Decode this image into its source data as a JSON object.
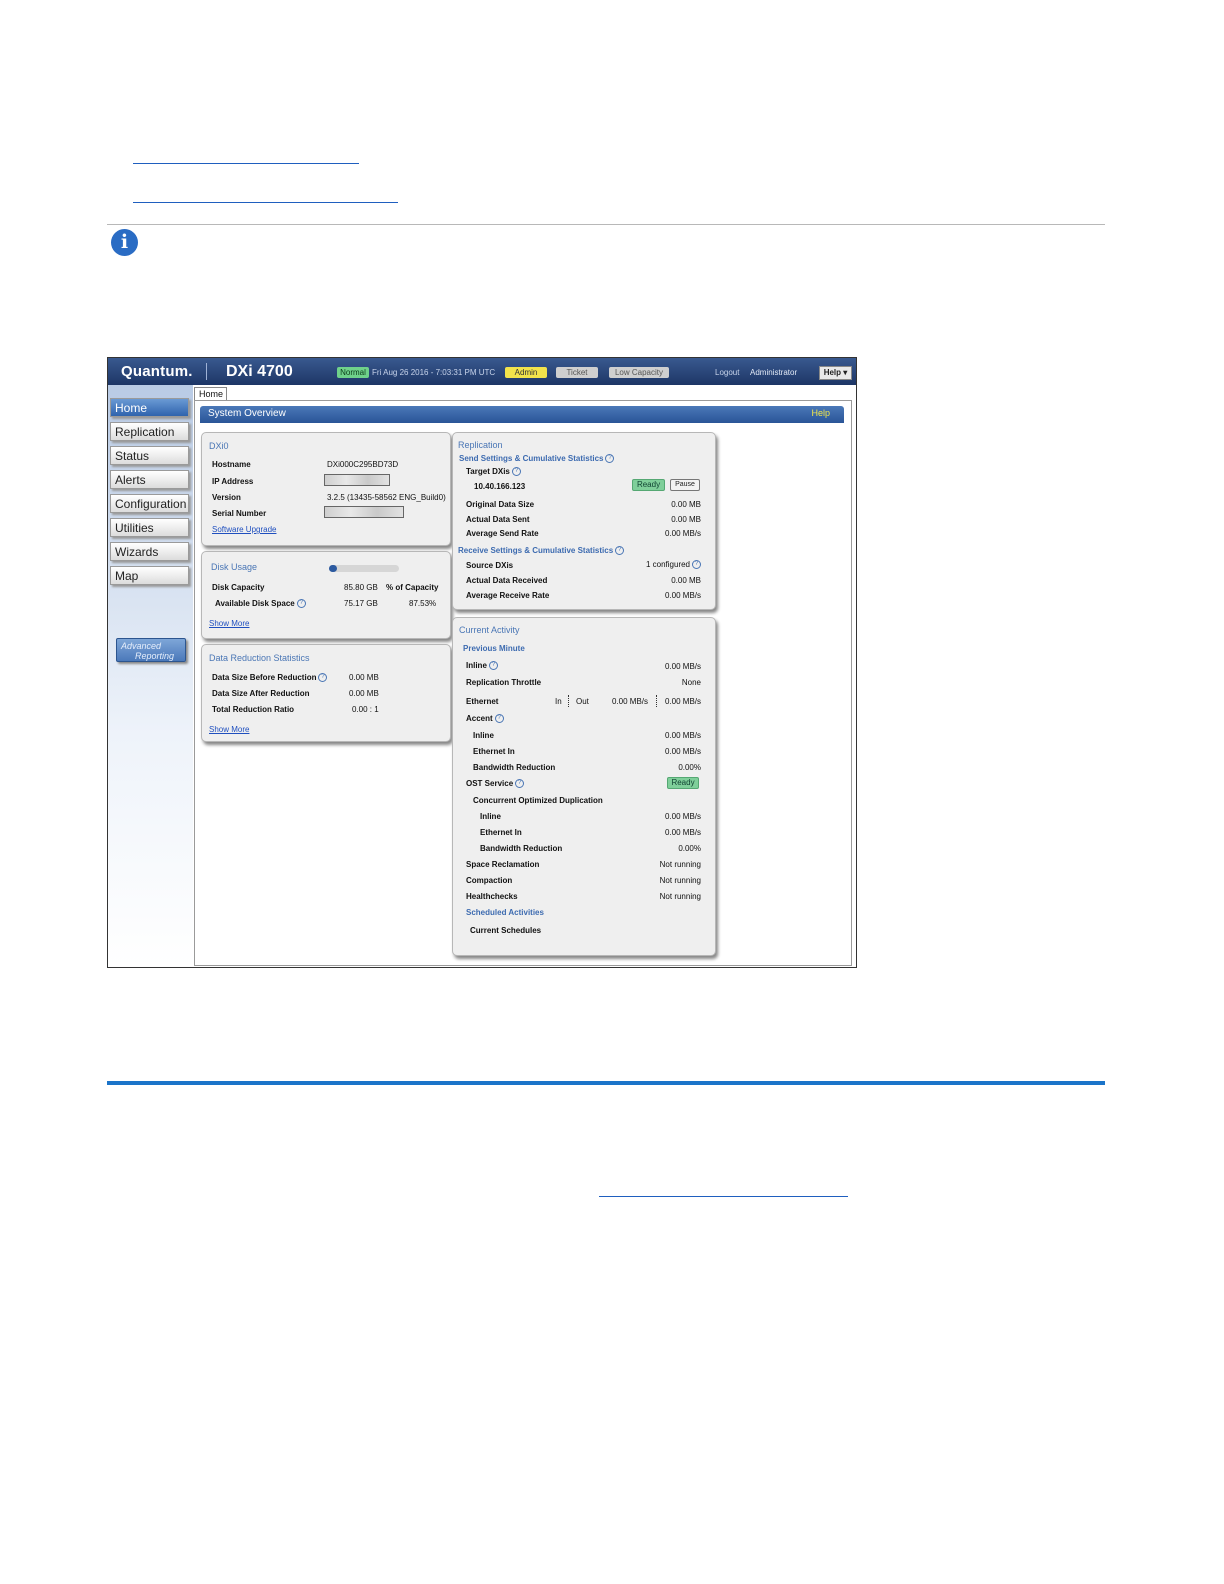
{
  "header": {
    "brand": "Quantum.",
    "model": "DXi 4700",
    "status_normal": "Normal",
    "datetime": "Fri Aug 26 2016 - 7:03:31 PM UTC",
    "admin": "Admin",
    "ticket": "Ticket",
    "low_capacity": "Low Capacity",
    "logout": "Logout",
    "user": "Administrator",
    "help": "Help ▾"
  },
  "sidebar": {
    "items": [
      "Home",
      "Replication",
      "Status",
      "Alerts",
      "Configuration",
      "Utilities",
      "Wizards",
      "Map"
    ],
    "advanced_line1": "Advanced",
    "advanced_line2": "Reporting"
  },
  "tab": "Home",
  "title_bar": {
    "title": "System Overview",
    "help": "Help"
  },
  "dxi_panel": {
    "heading": "DXi0",
    "hostname_label": "Hostname",
    "hostname_value": "DXi000C295BD73D",
    "ip_label": "IP Address",
    "version_label": "Version",
    "version_value": "3.2.5 (13435-58562 ENG_Build0)",
    "serial_label": "Serial Number",
    "upgrade_link": "Software Upgrade"
  },
  "disk_panel": {
    "heading": "Disk Usage",
    "capacity_label": "Disk Capacity",
    "capacity_value": "85.80 GB",
    "pct_header": "% of Capacity",
    "available_label": "Available Disk Space",
    "available_value": "75.17 GB",
    "available_pct": "87.53%",
    "used_fraction": 0.12,
    "show_more": "Show More"
  },
  "reduction_panel": {
    "heading": "Data Reduction Statistics",
    "before_label": "Data Size Before Reduction",
    "before_value": "0.00 MB",
    "after_label": "Data Size After Reduction",
    "after_value": "0.00 MB",
    "ratio_label": "Total Reduction Ratio",
    "ratio_value": "0.00 : 1",
    "show_more": "Show More"
  },
  "replication_panel": {
    "heading": "Replication",
    "send_heading": "Send Settings & Cumulative Statistics",
    "target_label": "Target DXis",
    "target_ip": "10.40.166.123",
    "ready": "Ready",
    "pause": "Pause",
    "orig_label": "Original Data Size",
    "orig_value": "0.00 MB",
    "sent_label": "Actual Data Sent",
    "sent_value": "0.00 MB",
    "send_rate_label": "Average Send Rate",
    "send_rate_value": "0.00 MB/s",
    "receive_heading": "Receive Settings & Cumulative Statistics",
    "source_label": "Source DXis",
    "source_value": "1 configured",
    "received_label": "Actual Data Received",
    "received_value": "0.00 MB",
    "recv_rate_label": "Average Receive Rate",
    "recv_rate_value": "0.00 MB/s"
  },
  "activity_panel": {
    "heading": "Current Activity",
    "prev_minute": "Previous Minute",
    "inline_label": "Inline",
    "inline_value": "0.00 MB/s",
    "throttle_label": "Replication Throttle",
    "throttle_value": "None",
    "ethernet_label": "Ethernet",
    "in_label": "In",
    "out_label": "Out",
    "eth_in_value": "0.00 MB/s",
    "eth_out_value": "0.00 MB/s",
    "accent_label": "Accent",
    "acc_inline_label": "Inline",
    "acc_inline_value": "0.00 MB/s",
    "acc_eth_label": "Ethernet In",
    "acc_eth_value": "0.00 MB/s",
    "acc_bw_label": "Bandwidth Reduction",
    "acc_bw_value": "0.00%",
    "ost_label": "OST Service",
    "ost_status": "Ready",
    "cod_label": "Concurrent Optimized Duplication",
    "cod_inline_label": "Inline",
    "cod_inline_value": "0.00 MB/s",
    "cod_eth_label": "Ethernet In",
    "cod_eth_value": "0.00 MB/s",
    "cod_bw_label": "Bandwidth Reduction",
    "cod_bw_value": "0.00%",
    "space_label": "Space Reclamation",
    "space_value": "Not running",
    "compaction_label": "Compaction",
    "compaction_value": "Not running",
    "health_label": "Healthchecks",
    "health_value": "Not running",
    "scheduled_heading": "Scheduled Activities",
    "current_schedules": "Current Schedules"
  },
  "colors": {
    "doc_link": "#1f5fbf",
    "rule_blue": "#1b74c9",
    "header_blue": "#1d3666"
  }
}
